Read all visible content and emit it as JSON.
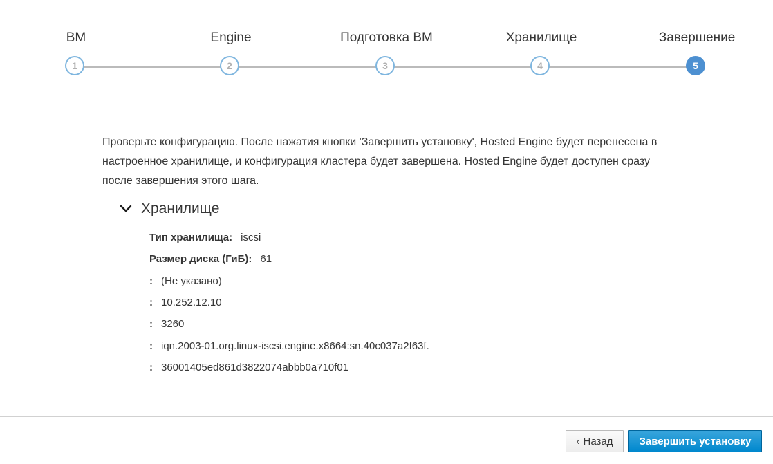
{
  "wizard": {
    "steps": [
      {
        "title": "ВМ",
        "number": "1",
        "active": false
      },
      {
        "title": "Engine",
        "number": "2",
        "active": false
      },
      {
        "title": "Подготовка ВМ",
        "number": "3",
        "active": false
      },
      {
        "title": "Хранилище",
        "number": "4",
        "active": false
      },
      {
        "title": "Завершение",
        "number": "5",
        "active": true
      }
    ]
  },
  "content": {
    "intro": "Проверьте конфигурацию. После нажатия кнопки 'Завершить установку', Hosted Engine будет перенесена в настроенное хранилище, и конфигурация кластера будет завершена. Hosted Engine будет доступен сразу после завершения этого шага.",
    "section_title": "Хранилище",
    "details": [
      {
        "label": "Тип хранилища:",
        "value": "iscsi"
      },
      {
        "label": "Размер диска (ГиБ):",
        "value": "61"
      },
      {
        "label": ":",
        "value": "(Не указано)"
      },
      {
        "label": ":",
        "value": "10.252.12.10"
      },
      {
        "label": ":",
        "value": "3260"
      },
      {
        "label": ":",
        "value": "iqn.2003-01.org.linux-iscsi.engine.x8664:sn.40c037a2f63f."
      },
      {
        "label": ":",
        "value": "36001405ed861d3822074abbb0a710f01"
      }
    ]
  },
  "footer": {
    "back_label": "Назад",
    "back_icon": "‹",
    "finish_label": "Завершить установку"
  },
  "colors": {
    "primary": "#0088ce",
    "step_active": "#4d90d1",
    "step_border": "#7fb6df"
  }
}
